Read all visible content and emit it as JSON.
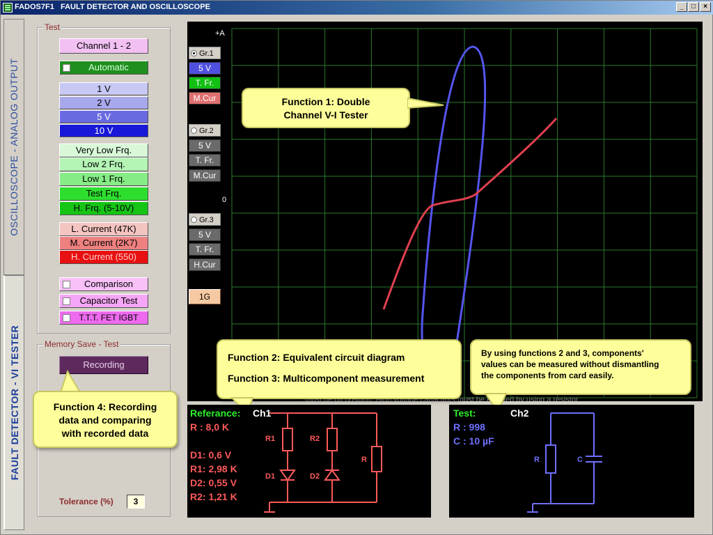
{
  "titlebar": {
    "app_name": "FADOS7F1",
    "title": "FAULT DETECTOR AND OSCILLOSCOPE",
    "min": "_",
    "max": "□",
    "close": "×"
  },
  "tabs": {
    "oscilloscope": "OSCILLOSCOPE - ANALOG OUTPUT",
    "fault_detector": "FAULT DETECTOR - VI TESTER"
  },
  "test_group": {
    "legend": "Test",
    "channel_button": "Channel 1 - 2",
    "automatic": "Automatic",
    "voltages": [
      "1 V",
      "2 V",
      "5 V",
      "10 V"
    ],
    "frequencies": [
      "Very Low Frq.",
      "Low 2 Frq.",
      "Low 1 Frq.",
      "Test Frq.",
      "H. Frq. (5-10V)"
    ],
    "currents": [
      "L. Current (47K)",
      "M. Current (2K7)",
      "H. Current (550)"
    ],
    "comparison": "Comparison",
    "capacitor_test": "Capacitor Test",
    "ttt": "T.T.T. FET  IGBT"
  },
  "memory_group": {
    "legend": "Memory Save - Test",
    "recording": "Recording",
    "tolerance_label": "Tolerance (%)",
    "tolerance_value": "3"
  },
  "graphs": [
    {
      "radio": "Gr.1",
      "volt": "5 V",
      "freq": "T. Fr.",
      "cur": "M.Cur"
    },
    {
      "radio": "Gr.2",
      "volt": "5 V",
      "freq": "T. Fr.",
      "cur": "M.Cur"
    },
    {
      "radio": "Gr.3",
      "volt": "5 V",
      "freq": "T. Fr.",
      "cur": "H.Cur"
    }
  ],
  "one_g": "1G",
  "screen": {
    "axis_top": "+A",
    "axis_zero": "0",
    "warning_text": "...must be off position. High voltage capacitors must be emptied by using a resistor"
  },
  "callouts": {
    "f1_line1": "Function 1: Double",
    "f1_line2": "Channel V-I Tester",
    "f2": "Function 2: Equivalent circuit diagram",
    "f3": "Function 3: Multicomponent measurement",
    "f23_line1": "By using functions 2 and 3, components'",
    "f23_line2": "values can be measured without dismantling",
    "f23_line3": "the components from card easily.",
    "f4_line1": "Function 4: Recording",
    "f4_line2": "data and comparing",
    "f4_line3": "with recorded data"
  },
  "reference_panel": {
    "label": "Referance:",
    "channel": "Ch1",
    "r": "R : 8,0 K",
    "d1": "D1: 0,6 V",
    "r1": "R1: 2,98 K",
    "d2": "D2: 0,55 V",
    "r2": "R2: 1,21 K",
    "circ_r1": "R1",
    "circ_r2": "R2",
    "circ_r": "R",
    "circ_d1": "D1",
    "circ_d2": "D2"
  },
  "test_panel": {
    "label": "Test:",
    "channel": "Ch2",
    "r": "R : 998",
    "c": "C : 10 µF",
    "circ_r": "R",
    "circ_c": "C"
  },
  "colors": {
    "reference": "#ff5a5a",
    "test": "#6f6fff",
    "trace_blue": "#5555ee",
    "trace_red": "#e04050",
    "grid": "#2b7a2b"
  }
}
